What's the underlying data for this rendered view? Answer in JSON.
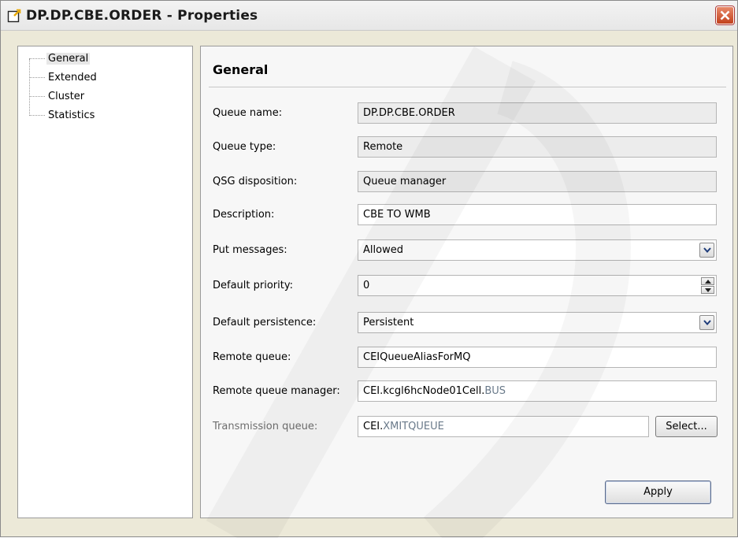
{
  "window": {
    "title": "DP.DP.CBE.ORDER - Properties"
  },
  "tree": {
    "items": [
      {
        "label": "General",
        "selected": true
      },
      {
        "label": "Extended",
        "selected": false
      },
      {
        "label": "Cluster",
        "selected": false
      },
      {
        "label": "Statistics",
        "selected": false
      }
    ]
  },
  "general": {
    "title": "General",
    "queue_name": {
      "label": "Queue name:",
      "value": "DP.DP.CBE.ORDER"
    },
    "queue_type": {
      "label": "Queue type:",
      "value": "Remote"
    },
    "qsg_disposition": {
      "label": "QSG disposition:",
      "value": "Queue manager"
    },
    "description": {
      "label": "Description:",
      "value": "CBE TO WMB"
    },
    "put_messages": {
      "label": "Put messages:",
      "value": "Allowed"
    },
    "default_priority": {
      "label": "Default priority:",
      "value": "0"
    },
    "default_persistence": {
      "label": "Default persistence:",
      "value": "Persistent"
    },
    "remote_queue": {
      "label": "Remote queue:",
      "value": "CEIQueueAliasForMQ"
    },
    "remote_queue_manager": {
      "label": "Remote queue manager:",
      "value_main": "CEI.kcgl6hcNode01Cell.",
      "value_dim": "BUS"
    },
    "transmission_queue": {
      "label": "Transmission queue:",
      "value_main": "CEI.",
      "value_dim": "XMITQUEUE"
    },
    "select_label": "Select...",
    "apply_label": "Apply"
  },
  "colors": {
    "close_button": "#c2401c",
    "panel_background": "#f7f7f7"
  }
}
